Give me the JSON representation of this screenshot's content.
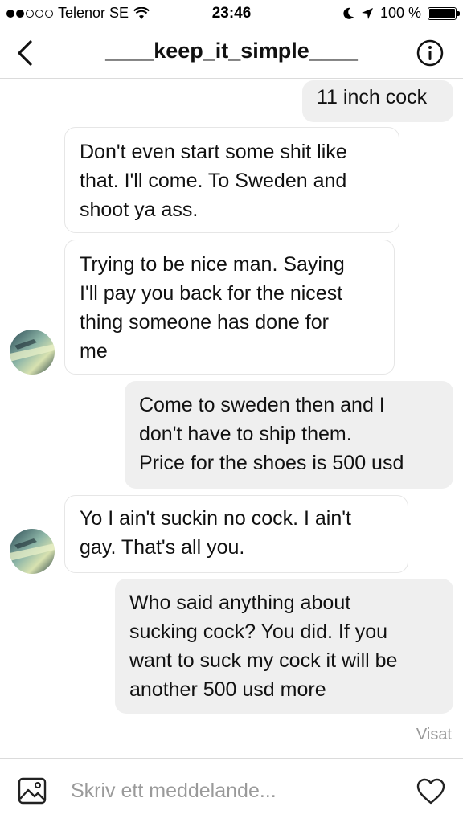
{
  "status_bar": {
    "carrier": "Telenor SE",
    "time": "23:46",
    "battery": "100 %",
    "battery_level": 1.0
  },
  "header": {
    "title": "____keep_it_simple____"
  },
  "messages": [
    {
      "direction": "outgoing",
      "text": "11 inch cock"
    },
    {
      "direction": "incoming",
      "lines": [
        "Don't even start some shit like",
        "that. I'll come. To Sweden and",
        "shoot ya ass."
      ]
    },
    {
      "direction": "incoming",
      "lines": [
        "Trying to be nice man. Saying",
        "I'll pay you back for the nicest",
        "thing someone has done for",
        "me"
      ]
    },
    {
      "direction": "outgoing",
      "lines": [
        "Come to sweden then and I",
        "don't have to ship them.",
        "Price for the shoes is 500 usd"
      ]
    },
    {
      "direction": "incoming",
      "lines": [
        "Yo I ain't suckin no cock.  I ain't",
        "gay. That's all you."
      ]
    },
    {
      "direction": "outgoing",
      "lines": [
        "Who said anything about",
        "sucking cock? You did. If you",
        "want to suck my cock it will be",
        "another 500 usd more"
      ]
    }
  ],
  "seen_label": "Visat",
  "composer": {
    "placeholder": "Skriv ett meddelande...",
    "value": ""
  },
  "icons": {
    "back": "chevron-left-icon",
    "info": "info-icon",
    "photo": "image-icon",
    "like": "heart-icon"
  }
}
